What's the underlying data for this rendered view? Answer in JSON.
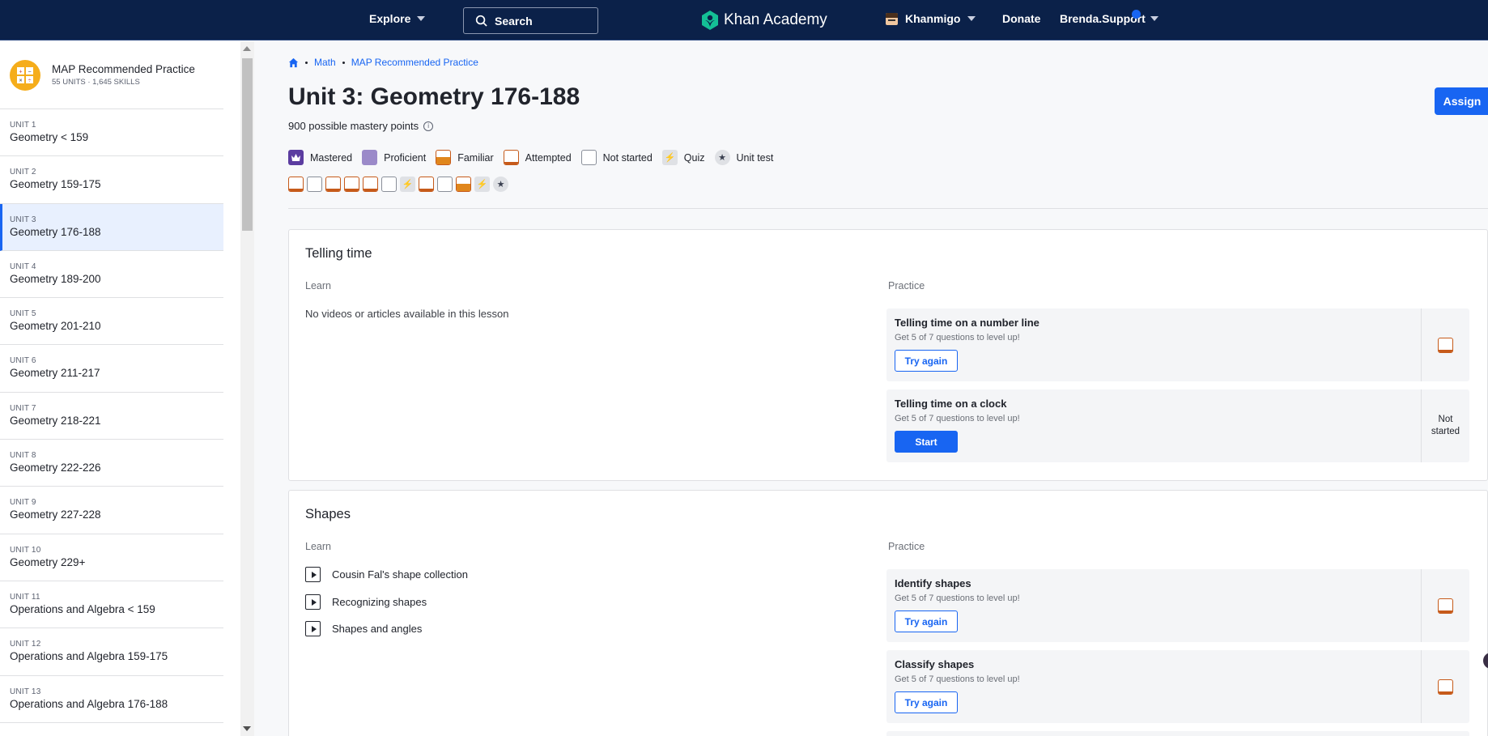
{
  "nav": {
    "explore": "Explore",
    "search": "Search",
    "logo": "Khan Academy",
    "khanmigo": "Khanmigo",
    "donate": "Donate",
    "user": "Brenda.Support"
  },
  "sidebar": {
    "course_title": "MAP Recommended Practice",
    "course_sub": "55 UNITS · 1,645 SKILLS",
    "units": [
      {
        "label": "UNIT 1",
        "title": "Geometry < 159"
      },
      {
        "label": "UNIT 2",
        "title": "Geometry 159-175"
      },
      {
        "label": "UNIT 3",
        "title": "Geometry 176-188"
      },
      {
        "label": "UNIT 4",
        "title": "Geometry 189-200"
      },
      {
        "label": "UNIT 5",
        "title": "Geometry 201-210"
      },
      {
        "label": "UNIT 6",
        "title": "Geometry 211-217"
      },
      {
        "label": "UNIT 7",
        "title": "Geometry 218-221"
      },
      {
        "label": "UNIT 8",
        "title": "Geometry 222-226"
      },
      {
        "label": "UNIT 9",
        "title": "Geometry 227-228"
      },
      {
        "label": "UNIT 10",
        "title": "Geometry 229+"
      },
      {
        "label": "UNIT 11",
        "title": "Operations and Algebra < 159"
      },
      {
        "label": "UNIT 12",
        "title": "Operations and Algebra 159-175"
      },
      {
        "label": "UNIT 13",
        "title": "Operations and Algebra 176-188"
      }
    ],
    "active_unit_index": 2
  },
  "main": {
    "breadcrumb": [
      "Math",
      "MAP Recommended Practice"
    ],
    "title": "Unit 3: Geometry 176-188",
    "mastery_points": "900 possible mastery points",
    "assign": "Assign",
    "legend": {
      "mastered": "Mastered",
      "proficient": "Proficient",
      "familiar": "Familiar",
      "attempted": "Attempted",
      "not_started": "Not started",
      "quiz": "Quiz",
      "unit_test": "Unit test"
    },
    "skill_progress": [
      "attempted",
      "not-started",
      "attempted",
      "attempted",
      "attempted",
      "not-started",
      "quiz",
      "attempted",
      "not-started",
      "familiar",
      "quiz",
      "unit-test"
    ],
    "lessons": [
      {
        "title": "Telling time",
        "learn_label": "Learn",
        "practice_label": "Practice",
        "no_content": "No videos or articles available in this lesson",
        "practice": [
          {
            "title": "Telling time on a number line",
            "sub": "Get 5 of 7 questions to level up!",
            "button": "Try again",
            "status": "attempted"
          },
          {
            "title": "Telling time on a clock",
            "sub": "Get 5 of 7 questions to level up!",
            "button": "Start",
            "status_text": "Not started"
          }
        ]
      },
      {
        "title": "Shapes",
        "learn_label": "Learn",
        "practice_label": "Practice",
        "videos": [
          "Cousin Fal's shape collection",
          "Recognizing shapes",
          "Shapes and angles"
        ],
        "practice": [
          {
            "title": "Identify shapes",
            "sub": "Get 5 of 7 questions to level up!",
            "button": "Try again",
            "status": "attempted"
          },
          {
            "title": "Classify shapes",
            "sub": "Get 5 of 7 questions to level up!",
            "button": "Try again",
            "status": "attempted"
          }
        ]
      }
    ]
  },
  "colors": {
    "nav_bg": "#0b2149",
    "accent": "#1865f2",
    "mastered": "#5b3ca0",
    "proficient": "#9b8ac9",
    "familiar": "#e0861c",
    "attempted": "#c65a1a"
  },
  "icons": {
    "search": "search-icon",
    "logo": "khan-leaf-icon",
    "home": "home-icon",
    "info": "info-icon",
    "quiz": "lightning-icon",
    "unit_test": "star-icon",
    "video": "play-icon"
  }
}
